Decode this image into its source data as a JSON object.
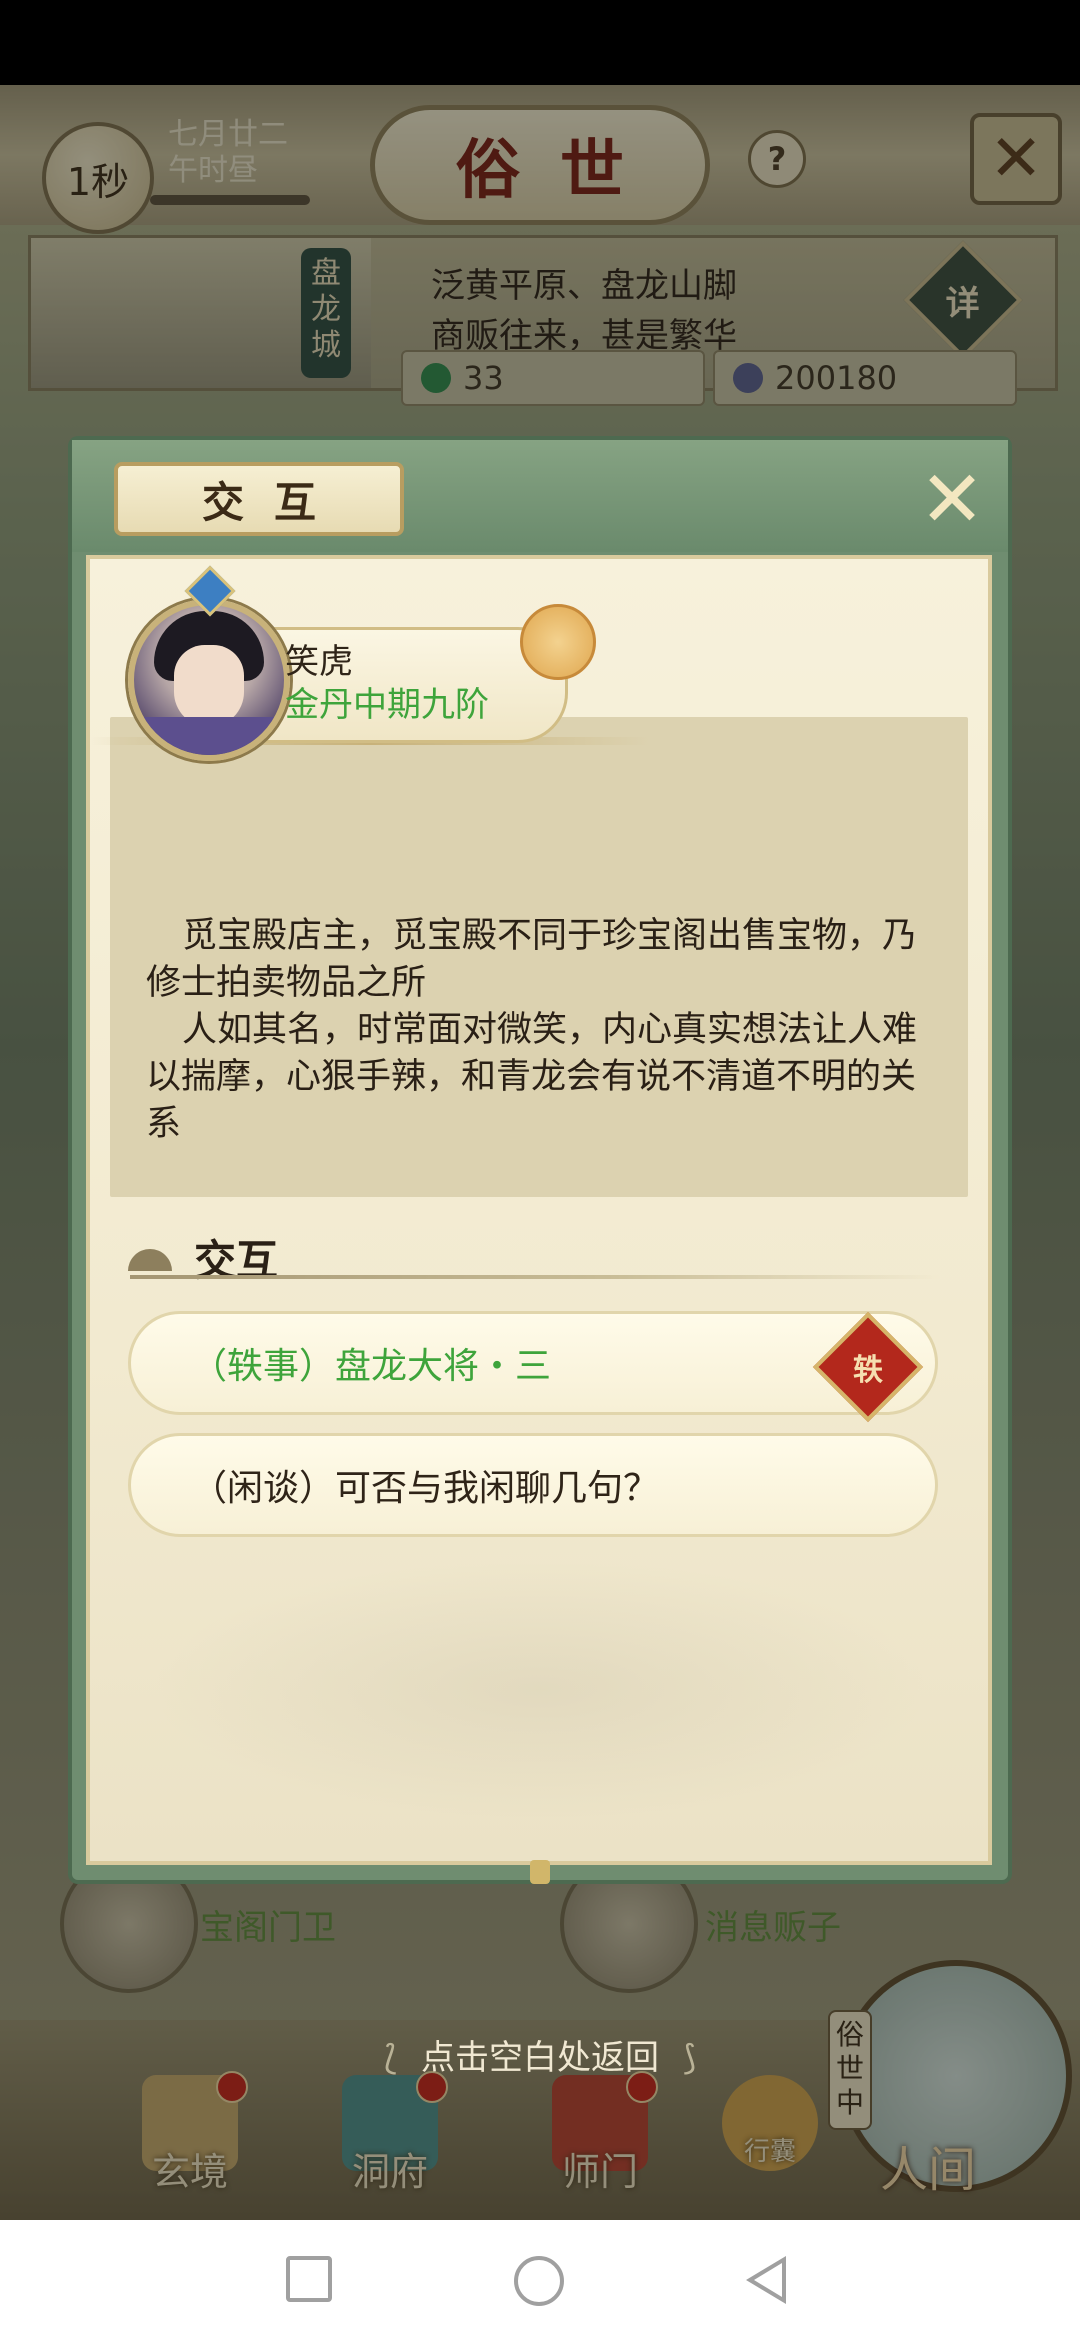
{
  "topbar": {
    "timer_label": "1秒",
    "date_line1": "七月廿二",
    "date_line2": "午时昼",
    "title": "俗世",
    "help_icon": "question-icon",
    "close_icon": "close-icon"
  },
  "location": {
    "city_name": "盘龙城",
    "line1": "泛黄平原、盘龙山脚",
    "line2": "商贩往来，甚是繁华",
    "detail_label": "详",
    "resource1_value": "33",
    "resource2_value": "200180"
  },
  "background_npcs": {
    "left_role": "宝阁门卫",
    "right_role": "消息贩子"
  },
  "dialog": {
    "title": "交互",
    "character": {
      "name": "笑虎",
      "realm": "金丹中期九阶"
    },
    "description": [
      "觅宝殿店主，觅宝殿不同于珍宝阁出售宝物，乃修士拍卖物品之所",
      "人如其名，时常面对微笑，内心真实想法让人难以揣摩，心狠手辣，和青龙会有说不清道不明的关系"
    ],
    "section_title": "交互",
    "options": [
      {
        "label": "（轶事）盘龙大将・三",
        "tag": "轶"
      },
      {
        "label": "（闲谈）可否与我闲聊几句？"
      }
    ]
  },
  "return_hint": "点击空白处返回",
  "bottom_nav": {
    "items": [
      {
        "label": "玄境"
      },
      {
        "label": "洞府"
      },
      {
        "label": "师门"
      },
      {
        "label": "行囊"
      }
    ],
    "world_tag": "俗世中",
    "world_label": "人间"
  },
  "colors": {
    "realm_green": "#3ea43b",
    "dialog_frame": "#6f8d70",
    "paper": "#f4ecd4",
    "title_red": "#7a1e12"
  }
}
